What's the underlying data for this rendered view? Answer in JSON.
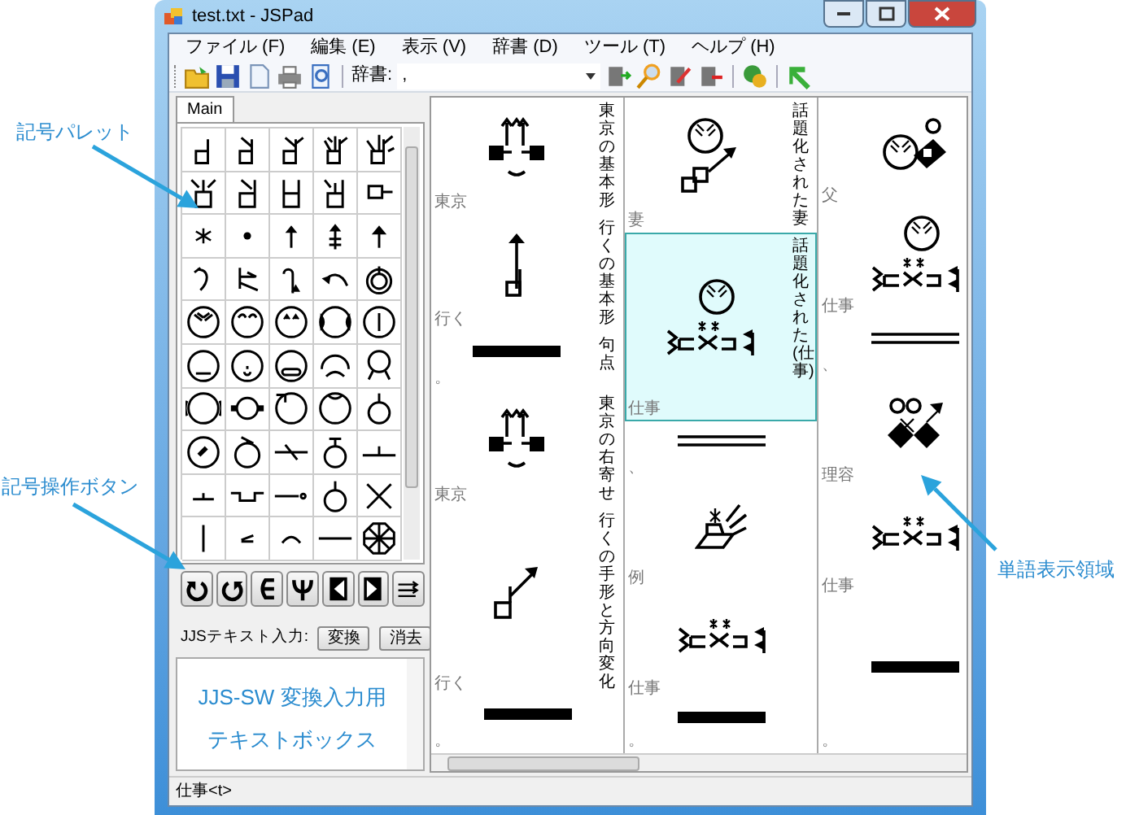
{
  "window": {
    "title": "test.txt - JSPad"
  },
  "menu": [
    "ファイル (F)",
    "編集 (E)",
    "表示 (V)",
    "辞書 (D)",
    "ツール (T)",
    "ヘルプ (H)"
  ],
  "toolbar": {
    "dictionary_label": "辞書:",
    "dictionary_value": ","
  },
  "palette": {
    "tabs": [
      {
        "label": "Main",
        "selected": true
      }
    ]
  },
  "jjs_input": {
    "label": "JJSテキスト入力:",
    "buttons": [
      "変換",
      "消去"
    ],
    "annotation_lines": [
      "JJS-SW 変換入力用",
      "テキストボックス"
    ]
  },
  "word_columns": [
    [
      {
        "kind": "tokyo",
        "label": "東京",
        "gloss": "東京の基本形",
        "selected": false
      },
      {
        "kind": "iku",
        "label": "行く",
        "gloss": "行くの基本形",
        "selected": false
      },
      {
        "kind": "period",
        "label": "。",
        "gloss": "句点",
        "selected": false
      },
      {
        "kind": "tokyo",
        "label": "東京",
        "gloss": "東京の右寄せ",
        "selected": false
      },
      {
        "kind": "ikumove",
        "label": "行く",
        "gloss": "行くの手形と方向変化",
        "selected": false
      },
      {
        "kind": "period",
        "label": "。",
        "selected": false
      }
    ],
    [
      {
        "kind": "tsuma",
        "label": "妻",
        "gloss": "話題化された妻",
        "selected": false
      },
      {
        "kind": "topicwork",
        "label": "仕事",
        "gloss": "話題化された(仕事)",
        "selected": true
      },
      {
        "kind": "comma",
        "label": "、",
        "selected": false
      },
      {
        "kind": "rei",
        "label": "例",
        "selected": false
      },
      {
        "kind": "work",
        "label": "仕事",
        "selected": false
      },
      {
        "kind": "period",
        "label": "。",
        "selected": false
      }
    ],
    [
      {
        "kind": "chichi",
        "label": "父",
        "selected": false
      },
      {
        "kind": "topicwork",
        "label": "仕事",
        "selected": false
      },
      {
        "kind": "comma",
        "label": "、",
        "selected": false
      },
      {
        "kind": "riyou",
        "label": "理容",
        "selected": false
      },
      {
        "kind": "work",
        "label": "仕事",
        "selected": false
      },
      {
        "kind": "period",
        "label": "。",
        "selected": false
      }
    ]
  ],
  "status_bar": "仕事<t>",
  "callouts": [
    {
      "text": "記号パレット"
    },
    {
      "text": "記号操作ボタン"
    },
    {
      "text": "単語表示領域"
    }
  ]
}
